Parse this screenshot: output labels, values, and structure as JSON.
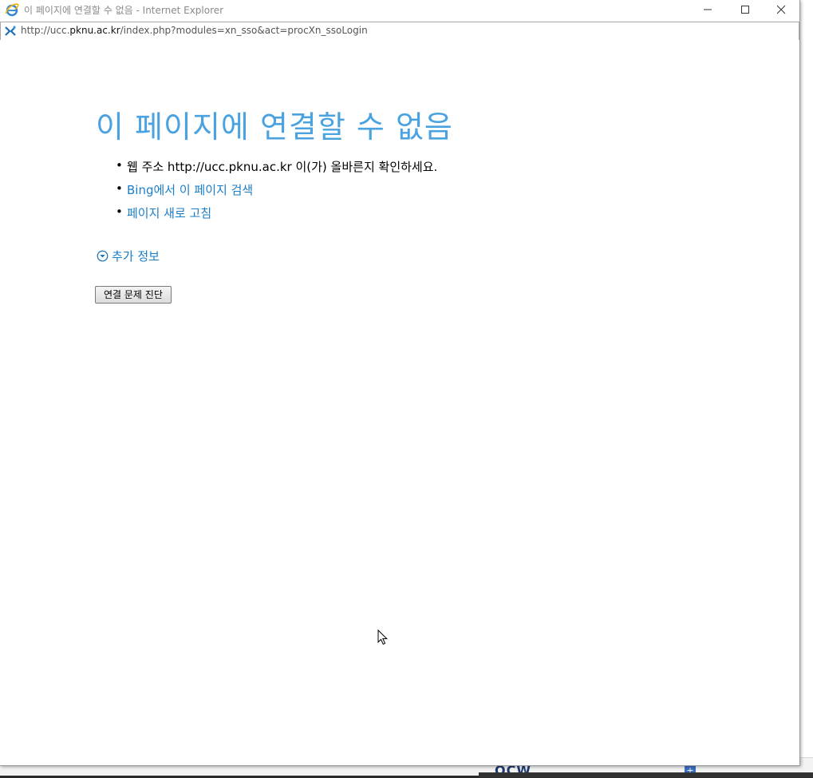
{
  "window": {
    "title": "이 페이지에 연결할 수 없음 - Internet Explorer",
    "controls": {
      "minimize": "minimize-icon",
      "maximize": "maximize-icon",
      "close": "close-icon"
    }
  },
  "address": {
    "prefix": "http://ucc.",
    "host": "pknu.ac.kr",
    "path": "/index.php?modules=xn_sso&act=procXn_ssoLogin",
    "icon": "site-error-icon"
  },
  "page": {
    "title": "이 페이지에 연결할 수 없음",
    "suggestions": [
      {
        "text": "웹 주소 http://ucc.pknu.ac.kr 이(가) 올바른지 확인하세요.",
        "type": "text"
      },
      {
        "text": "Bing에서 이 페이지 검색",
        "type": "link"
      },
      {
        "text": "페이지 새로 고침",
        "type": "link"
      }
    ],
    "more_info": "추가 정보",
    "diagnose_button": "연결 문제 진단"
  },
  "background": {
    "ocw_label": "OCW",
    "plus_label": "+"
  },
  "colors": {
    "title_blue": "#4aa3e0",
    "link_blue": "#1a7ec9"
  }
}
